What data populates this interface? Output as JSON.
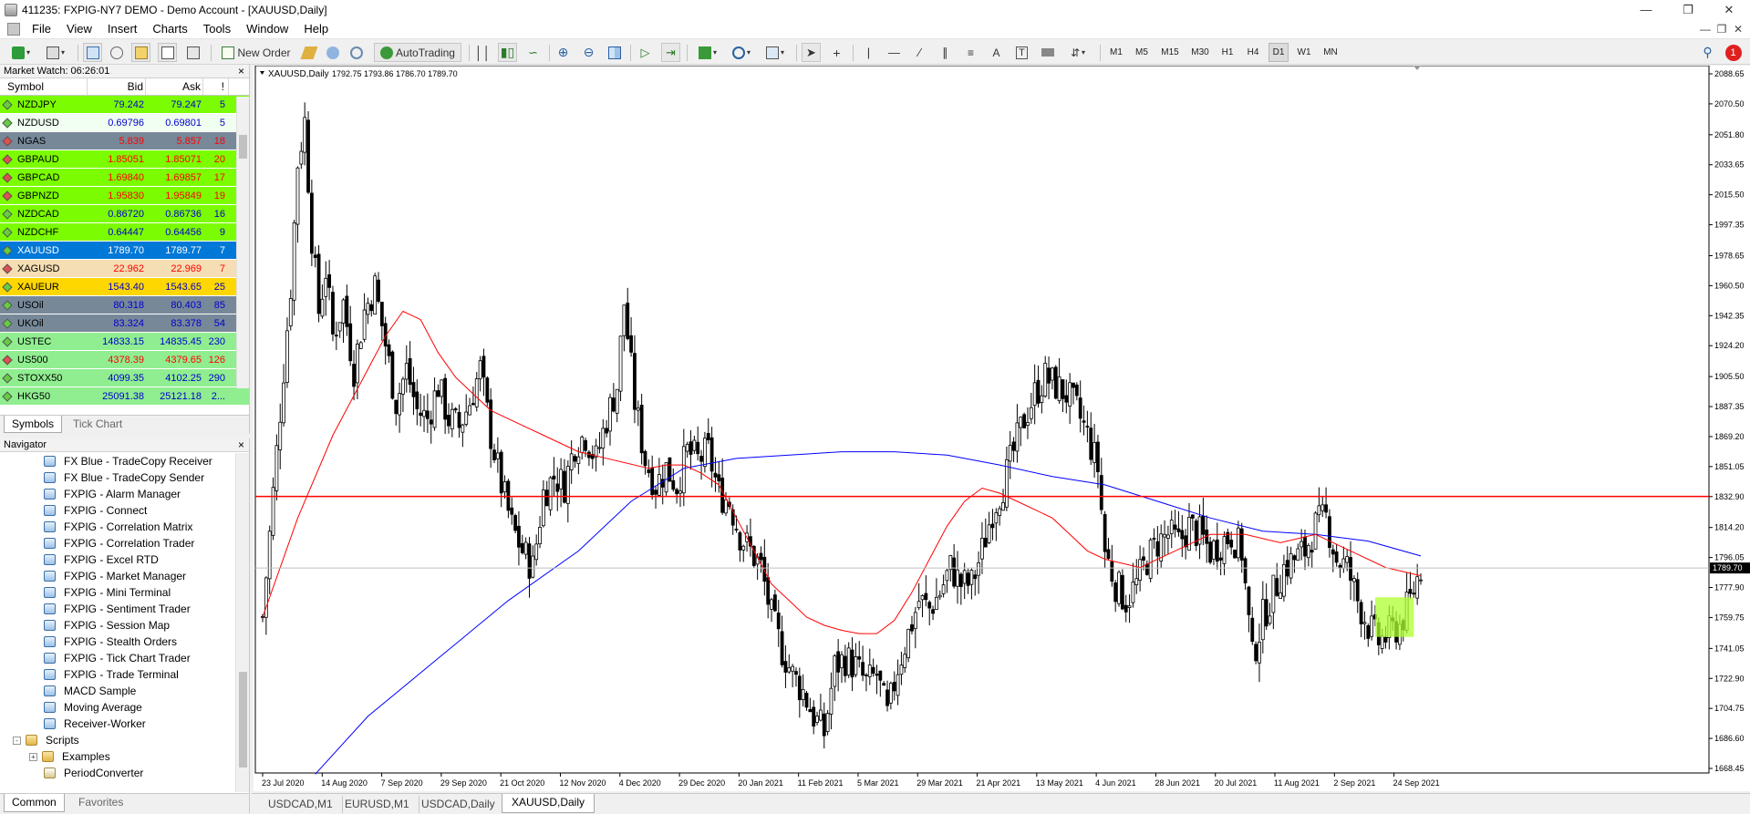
{
  "window": {
    "title": "411235: FXPIG-NY7 DEMO - Demo Account - [XAUUSD,Daily]"
  },
  "menu": [
    "File",
    "View",
    "Insert",
    "Charts",
    "Tools",
    "Window",
    "Help"
  ],
  "toolbar": {
    "new_order_label": "New Order",
    "autotrading_label": "AutoTrading",
    "timeframes": [
      "M1",
      "M5",
      "M15",
      "M30",
      "H1",
      "H4",
      "D1",
      "W1",
      "MN"
    ],
    "active_timeframe": "D1",
    "notification_count": "1"
  },
  "market_watch": {
    "header": "Market Watch: 06:26:01",
    "columns": {
      "symbol": "Symbol",
      "bid": "Bid",
      "ask": "Ask",
      "spread": "!"
    },
    "rows": [
      {
        "symbol": "NZDJPY",
        "bid": "79.242",
        "ask": "79.247",
        "spread": "5",
        "dir": "up",
        "bg": "#7cfc00",
        "fg": "#0000cc"
      },
      {
        "symbol": "NZDUSD",
        "bid": "0.69796",
        "ask": "0.69801",
        "spread": "5",
        "dir": "up",
        "bg": "#f0fff0",
        "fg": "#0000cc"
      },
      {
        "symbol": "NGAS",
        "bid": "5.839",
        "ask": "5.857",
        "spread": "18",
        "dir": "dn",
        "bg": "#778899",
        "fg": "#ff0000"
      },
      {
        "symbol": "GBPAUD",
        "bid": "1.85051",
        "ask": "1.85071",
        "spread": "20",
        "dir": "dn",
        "bg": "#7cfc00",
        "fg": "#ff0000"
      },
      {
        "symbol": "GBPCAD",
        "bid": "1.69840",
        "ask": "1.69857",
        "spread": "17",
        "dir": "dn",
        "bg": "#7cfc00",
        "fg": "#ff0000"
      },
      {
        "symbol": "GBPNZD",
        "bid": "1.95830",
        "ask": "1.95849",
        "spread": "19",
        "dir": "dn",
        "bg": "#7cfc00",
        "fg": "#ff0000"
      },
      {
        "symbol": "NZDCAD",
        "bid": "0.86720",
        "ask": "0.86736",
        "spread": "16",
        "dir": "up",
        "bg": "#7cfc00",
        "fg": "#0000cc"
      },
      {
        "symbol": "NZDCHF",
        "bid": "0.64447",
        "ask": "0.64456",
        "spread": "9",
        "dir": "up",
        "bg": "#7cfc00",
        "fg": "#0000cc"
      },
      {
        "symbol": "XAUUSD",
        "bid": "1789.70",
        "ask": "1789.77",
        "spread": "7",
        "dir": "up",
        "bg": "#0078d7",
        "fg": "#ffffff"
      },
      {
        "symbol": "XAGUSD",
        "bid": "22.962",
        "ask": "22.969",
        "spread": "7",
        "dir": "dn",
        "bg": "#f5deb3",
        "fg": "#ff0000"
      },
      {
        "symbol": "XAUEUR",
        "bid": "1543.40",
        "ask": "1543.65",
        "spread": "25",
        "dir": "up",
        "bg": "#ffd700",
        "fg": "#0000cc"
      },
      {
        "symbol": "USOil",
        "bid": "80.318",
        "ask": "80.403",
        "spread": "85",
        "dir": "up",
        "bg": "#778899",
        "fg": "#0000cc"
      },
      {
        "symbol": "UKOil",
        "bid": "83.324",
        "ask": "83.378",
        "spread": "54",
        "dir": "up",
        "bg": "#778899",
        "fg": "#0000cc"
      },
      {
        "symbol": "USTEC",
        "bid": "14833.15",
        "ask": "14835.45",
        "spread": "230",
        "dir": "up",
        "bg": "#90ee90",
        "fg": "#0000cc"
      },
      {
        "symbol": "US500",
        "bid": "4378.39",
        "ask": "4379.65",
        "spread": "126",
        "dir": "dn",
        "bg": "#90ee90",
        "fg": "#ff0000"
      },
      {
        "symbol": "STOXX50",
        "bid": "4099.35",
        "ask": "4102.25",
        "spread": "290",
        "dir": "up",
        "bg": "#90ee90",
        "fg": "#0000cc"
      },
      {
        "symbol": "HKG50",
        "bid": "25091.38",
        "ask": "25121.18",
        "spread": "2...",
        "dir": "up",
        "bg": "#90ee90",
        "fg": "#0000cc"
      }
    ],
    "tabs": [
      "Symbols",
      "Tick Chart"
    ]
  },
  "navigator": {
    "header": "Navigator",
    "items": [
      {
        "label": "FX Blue - TradeCopy Receiver",
        "icon": "ea-icon",
        "indent": 3
      },
      {
        "label": "FX Blue - TradeCopy Sender",
        "icon": "ea-icon",
        "indent": 3
      },
      {
        "label": "FXPIG - Alarm Manager",
        "icon": "ea-icon",
        "indent": 3
      },
      {
        "label": "FXPIG - Connect",
        "icon": "ea-icon",
        "indent": 3
      },
      {
        "label": "FXPIG - Correlation Matrix",
        "icon": "ea-icon",
        "indent": 3
      },
      {
        "label": "FXPIG - Correlation Trader",
        "icon": "ea-icon",
        "indent": 3
      },
      {
        "label": "FXPIG - Excel RTD",
        "icon": "ea-icon",
        "indent": 3
      },
      {
        "label": "FXPIG - Market Manager",
        "icon": "ea-icon",
        "indent": 3
      },
      {
        "label": "FXPIG - Mini Terminal",
        "icon": "ea-icon",
        "indent": 3
      },
      {
        "label": "FXPIG - Sentiment Trader",
        "icon": "ea-icon",
        "indent": 3
      },
      {
        "label": "FXPIG - Session Map",
        "icon": "ea-icon",
        "indent": 3
      },
      {
        "label": "FXPIG - Stealth Orders",
        "icon": "ea-icon",
        "indent": 3
      },
      {
        "label": "FXPIG - Tick Chart Trader",
        "icon": "ea-icon",
        "indent": 3
      },
      {
        "label": "FXPIG - Trade Terminal",
        "icon": "ea-icon",
        "indent": 3
      },
      {
        "label": "MACD Sample",
        "icon": "ea-icon",
        "indent": 3
      },
      {
        "label": "Moving Average",
        "icon": "ea-icon",
        "indent": 3
      },
      {
        "label": "Receiver-Worker",
        "icon": "ea-icon",
        "indent": 3
      },
      {
        "label": "Scripts",
        "icon": "folder-icon",
        "indent": 1,
        "toggle": "-"
      },
      {
        "label": "Examples",
        "icon": "folder-icon",
        "indent": 2,
        "toggle": "+"
      },
      {
        "label": "PeriodConverter",
        "icon": "script-icon",
        "indent": 3
      }
    ],
    "tabs": [
      "Common",
      "Favorites"
    ]
  },
  "chart": {
    "header": "XAUUSD,Daily",
    "ohlc": "1792.75 1793.86 1786.70 1789.70",
    "current_price": "1789.70",
    "tabs": [
      "USDCAD,M1",
      "EURUSD,M1",
      "USDCAD,Daily",
      "XAUUSD,Daily"
    ],
    "active_tab": "XAUUSD,Daily",
    "colors": {
      "ma_fast": "#ff0000",
      "ma_slow": "#0000ff",
      "hline": "#ff0000",
      "zone": "#adff2f",
      "bid_line": "#c0c0c0"
    }
  },
  "chart_data": {
    "type": "candlestick",
    "symbol": "XAUUSD",
    "timeframe": "Daily",
    "ylim": [
      1668.45,
      2088.65
    ],
    "y_ticks": [
      "2088.65",
      "2070.50",
      "2051.80",
      "2033.65",
      "2015.50",
      "1997.35",
      "1978.65",
      "1960.50",
      "1942.35",
      "1924.20",
      "1905.50",
      "1887.35",
      "1869.20",
      "1851.05",
      "1832.90",
      "1814.20",
      "1796.05",
      "1777.90",
      "1759.75",
      "1741.05",
      "1722.90",
      "1704.75",
      "1686.60",
      "1668.45"
    ],
    "x_ticks": [
      "23 Jul 2020",
      "14 Aug 2020",
      "7 Sep 2020",
      "29 Sep 2020",
      "21 Oct 2020",
      "12 Nov 2020",
      "4 Dec 2020",
      "29 Dec 2020",
      "20 Jan 2021",
      "11 Feb 2021",
      "5 Mar 2021",
      "29 Mar 2021",
      "21 Apr 2021",
      "13 May 2021",
      "4 Jun 2021",
      "28 Jun 2021",
      "20 Jul 2021",
      "11 Aug 2021",
      "2 Sep 2021",
      "24 Sep 2021"
    ],
    "horizontal_line": 1833.0,
    "close_path": [
      [
        0,
        1760
      ],
      [
        4,
        1860
      ],
      [
        8,
        1960
      ],
      [
        10,
        2035
      ],
      [
        12,
        2060
      ],
      [
        14,
        1990
      ],
      [
        16,
        1945
      ],
      [
        18,
        1970
      ],
      [
        20,
        1930
      ],
      [
        23,
        1950
      ],
      [
        26,
        1910
      ],
      [
        29,
        1945
      ],
      [
        32,
        1960
      ],
      [
        35,
        1925
      ],
      [
        38,
        1890
      ],
      [
        41,
        1910
      ],
      [
        44,
        1885
      ],
      [
        47,
        1880
      ],
      [
        50,
        1900
      ],
      [
        53,
        1880
      ],
      [
        56,
        1875
      ],
      [
        59,
        1890
      ],
      [
        62,
        1910
      ],
      [
        65,
        1870
      ],
      [
        68,
        1840
      ],
      [
        71,
        1815
      ],
      [
        74,
        1800
      ],
      [
        77,
        1790
      ],
      [
        80,
        1835
      ],
      [
        83,
        1845
      ],
      [
        86,
        1840
      ],
      [
        89,
        1865
      ],
      [
        92,
        1870
      ],
      [
        95,
        1855
      ],
      [
        98,
        1880
      ],
      [
        101,
        1900
      ],
      [
        103,
        1950
      ],
      [
        106,
        1890
      ],
      [
        109,
        1855
      ],
      [
        112,
        1840
      ],
      [
        115,
        1850
      ],
      [
        118,
        1840
      ],
      [
        121,
        1860
      ],
      [
        124,
        1855
      ],
      [
        127,
        1860
      ],
      [
        130,
        1835
      ],
      [
        133,
        1830
      ],
      [
        136,
        1810
      ],
      [
        139,
        1800
      ],
      [
        142,
        1790
      ],
      [
        145,
        1760
      ],
      [
        148,
        1740
      ],
      [
        151,
        1725
      ],
      [
        154,
        1715
      ],
      [
        157,
        1700
      ],
      [
        160,
        1690
      ],
      [
        163,
        1730
      ],
      [
        166,
        1735
      ],
      [
        169,
        1730
      ],
      [
        172,
        1720
      ],
      [
        175,
        1725
      ],
      [
        178,
        1700
      ],
      [
        181,
        1730
      ],
      [
        184,
        1750
      ],
      [
        187,
        1770
      ],
      [
        190,
        1765
      ],
      [
        193,
        1775
      ],
      [
        196,
        1790
      ],
      [
        199,
        1780
      ],
      [
        202,
        1780
      ],
      [
        205,
        1800
      ],
      [
        208,
        1825
      ],
      [
        211,
        1840
      ],
      [
        214,
        1860
      ],
      [
        217,
        1880
      ],
      [
        220,
        1895
      ],
      [
        223,
        1905
      ],
      [
        226,
        1900
      ],
      [
        229,
        1895
      ],
      [
        232,
        1885
      ],
      [
        235,
        1870
      ],
      [
        238,
        1850
      ],
      [
        240,
        1800
      ],
      [
        243,
        1780
      ],
      [
        246,
        1770
      ],
      [
        249,
        1780
      ],
      [
        252,
        1795
      ],
      [
        255,
        1805
      ],
      [
        258,
        1810
      ],
      [
        261,
        1805
      ],
      [
        264,
        1815
      ],
      [
        267,
        1810
      ],
      [
        270,
        1800
      ],
      [
        273,
        1805
      ],
      [
        276,
        1810
      ],
      [
        279,
        1800
      ],
      [
        282,
        1735
      ],
      [
        285,
        1760
      ],
      [
        288,
        1775
      ],
      [
        291,
        1790
      ],
      [
        294,
        1795
      ],
      [
        297,
        1800
      ],
      [
        300,
        1815
      ],
      [
        303,
        1820
      ],
      [
        306,
        1795
      ],
      [
        309,
        1790
      ],
      [
        312,
        1770
      ],
      [
        315,
        1755
      ],
      [
        318,
        1745
      ],
      [
        321,
        1750
      ],
      [
        324,
        1755
      ],
      [
        327,
        1770
      ],
      [
        330,
        1790
      ]
    ],
    "ma_fast_path": [
      [
        0,
        1760
      ],
      [
        10,
        1820
      ],
      [
        20,
        1870
      ],
      [
        30,
        1910
      ],
      [
        35,
        1930
      ],
      [
        40,
        1945
      ],
      [
        45,
        1940
      ],
      [
        50,
        1920
      ],
      [
        55,
        1905
      ],
      [
        60,
        1895
      ],
      [
        65,
        1885
      ],
      [
        70,
        1880
      ],
      [
        75,
        1875
      ],
      [
        80,
        1870
      ],
      [
        90,
        1860
      ],
      [
        100,
        1855
      ],
      [
        110,
        1850
      ],
      [
        115,
        1852
      ],
      [
        120,
        1852
      ],
      [
        125,
        1847
      ],
      [
        130,
        1840
      ],
      [
        135,
        1820
      ],
      [
        140,
        1800
      ],
      [
        145,
        1780
      ],
      [
        150,
        1770
      ],
      [
        155,
        1760
      ],
      [
        160,
        1755
      ],
      [
        165,
        1752
      ],
      [
        170,
        1750
      ],
      [
        175,
        1750
      ],
      [
        180,
        1758
      ],
      [
        185,
        1775
      ],
      [
        190,
        1795
      ],
      [
        195,
        1815
      ],
      [
        200,
        1830
      ],
      [
        205,
        1838
      ],
      [
        210,
        1835
      ],
      [
        215,
        1830
      ],
      [
        220,
        1825
      ],
      [
        225,
        1820
      ],
      [
        230,
        1810
      ],
      [
        235,
        1800
      ],
      [
        240,
        1795
      ],
      [
        250,
        1790
      ],
      [
        260,
        1800
      ],
      [
        270,
        1810
      ],
      [
        280,
        1810
      ],
      [
        290,
        1805
      ],
      [
        300,
        1810
      ],
      [
        310,
        1800
      ],
      [
        320,
        1790
      ],
      [
        330,
        1785
      ]
    ],
    "ma_slow_path": [
      [
        15,
        1665
      ],
      [
        30,
        1700
      ],
      [
        50,
        1735
      ],
      [
        70,
        1770
      ],
      [
        90,
        1800
      ],
      [
        105,
        1830
      ],
      [
        120,
        1850
      ],
      [
        135,
        1856
      ],
      [
        150,
        1858
      ],
      [
        165,
        1860
      ],
      [
        180,
        1860
      ],
      [
        195,
        1858
      ],
      [
        210,
        1852
      ],
      [
        225,
        1845
      ],
      [
        240,
        1840
      ],
      [
        255,
        1830
      ],
      [
        270,
        1820
      ],
      [
        285,
        1812
      ],
      [
        300,
        1810
      ],
      [
        315,
        1806
      ],
      [
        330,
        1797
      ]
    ]
  }
}
